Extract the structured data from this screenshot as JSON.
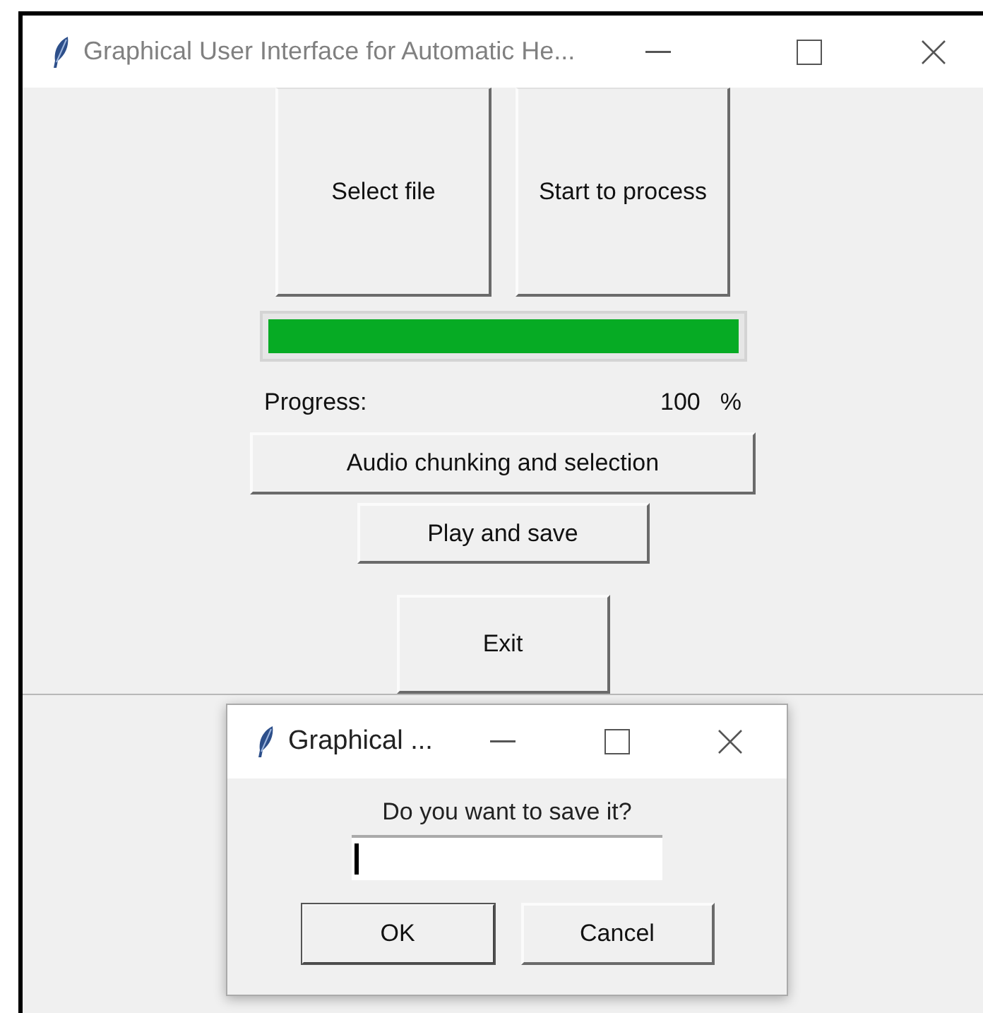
{
  "main_window": {
    "title": "Graphical User Interface for Automatic He...",
    "top_buttons": [
      "Select file",
      "Start to process"
    ],
    "progress": {
      "level": 1,
      "label": "Progress:",
      "value": "100",
      "unit": "%"
    },
    "action_buttons": [
      "Audio chunking and selection",
      "Play and save"
    ],
    "exit_button": "Exit"
  },
  "dialog": {
    "title": "Graphical ...",
    "message": "Do you want to save it?",
    "input": {
      "focused": true
    },
    "buttons": [
      {
        "label": "OK",
        "default": true
      },
      {
        "label": "Cancel",
        "default": false
      }
    ]
  }
}
